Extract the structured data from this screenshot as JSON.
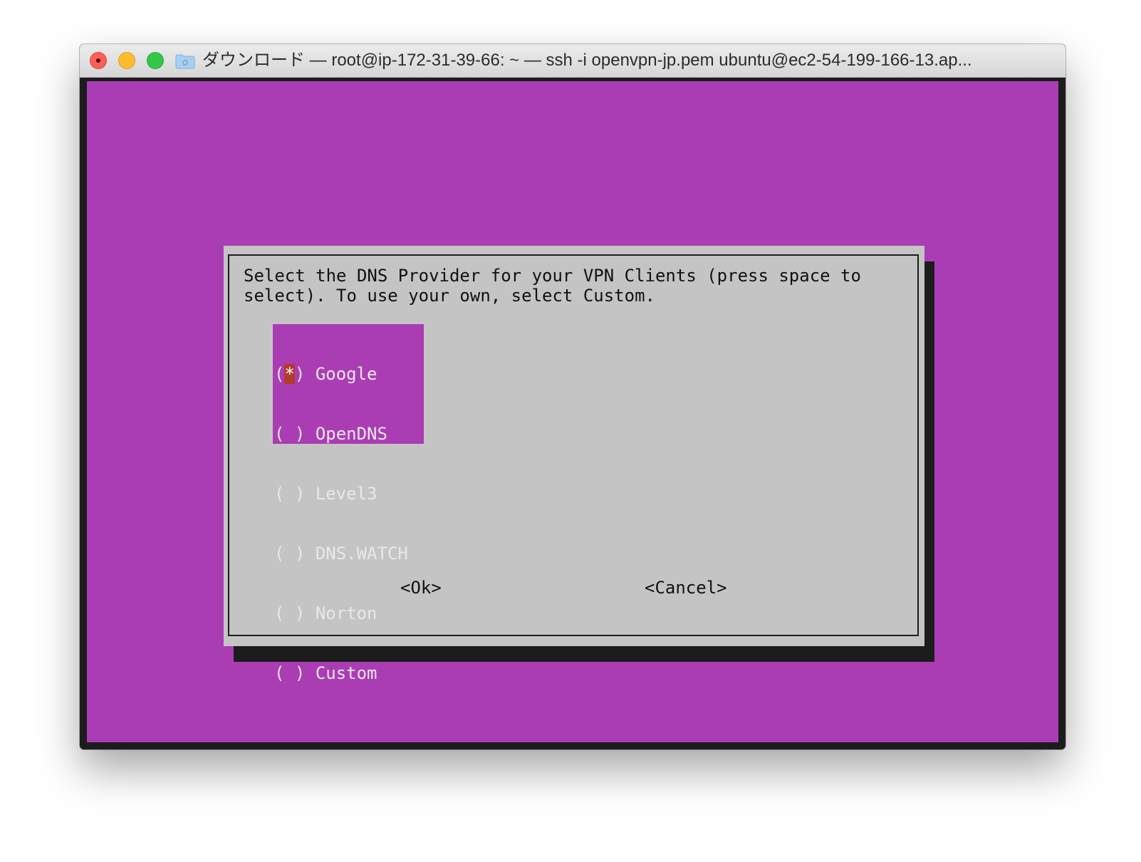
{
  "window": {
    "title": "ダウンロード — root@ip-172-31-39-66: ~ — ssh -i openvpn-jp.pem ubuntu@ec2-54-199-166-13.ap..."
  },
  "colors": {
    "terminal_bg": "#ab3db4",
    "dialog_bg": "#c4c4c4",
    "dialog_shadow": "#1c1c1c",
    "selected_marker": "#b23a2c",
    "list_text": "#e8e8e8"
  },
  "dialog": {
    "prompt_line1": "Select the DNS Provider for your VPN Clients (press space to",
    "prompt_line2": "select). To use your own, select Custom.",
    "options": [
      {
        "marker_open": "(",
        "marker": "*",
        "marker_close": ")",
        "label": "Google",
        "selected": true
      },
      {
        "marker_open": "(",
        "marker": " ",
        "marker_close": ")",
        "label": "OpenDNS",
        "selected": false
      },
      {
        "marker_open": "(",
        "marker": " ",
        "marker_close": ")",
        "label": "Level3",
        "selected": false
      },
      {
        "marker_open": "(",
        "marker": " ",
        "marker_close": ")",
        "label": "DNS.WATCH",
        "selected": false
      },
      {
        "marker_open": "(",
        "marker": " ",
        "marker_close": ")",
        "label": "Norton",
        "selected": false
      },
      {
        "marker_open": "(",
        "marker": " ",
        "marker_close": ")",
        "label": "Custom",
        "selected": false
      }
    ],
    "ok_label": "<Ok>",
    "cancel_label": "<Cancel>"
  }
}
